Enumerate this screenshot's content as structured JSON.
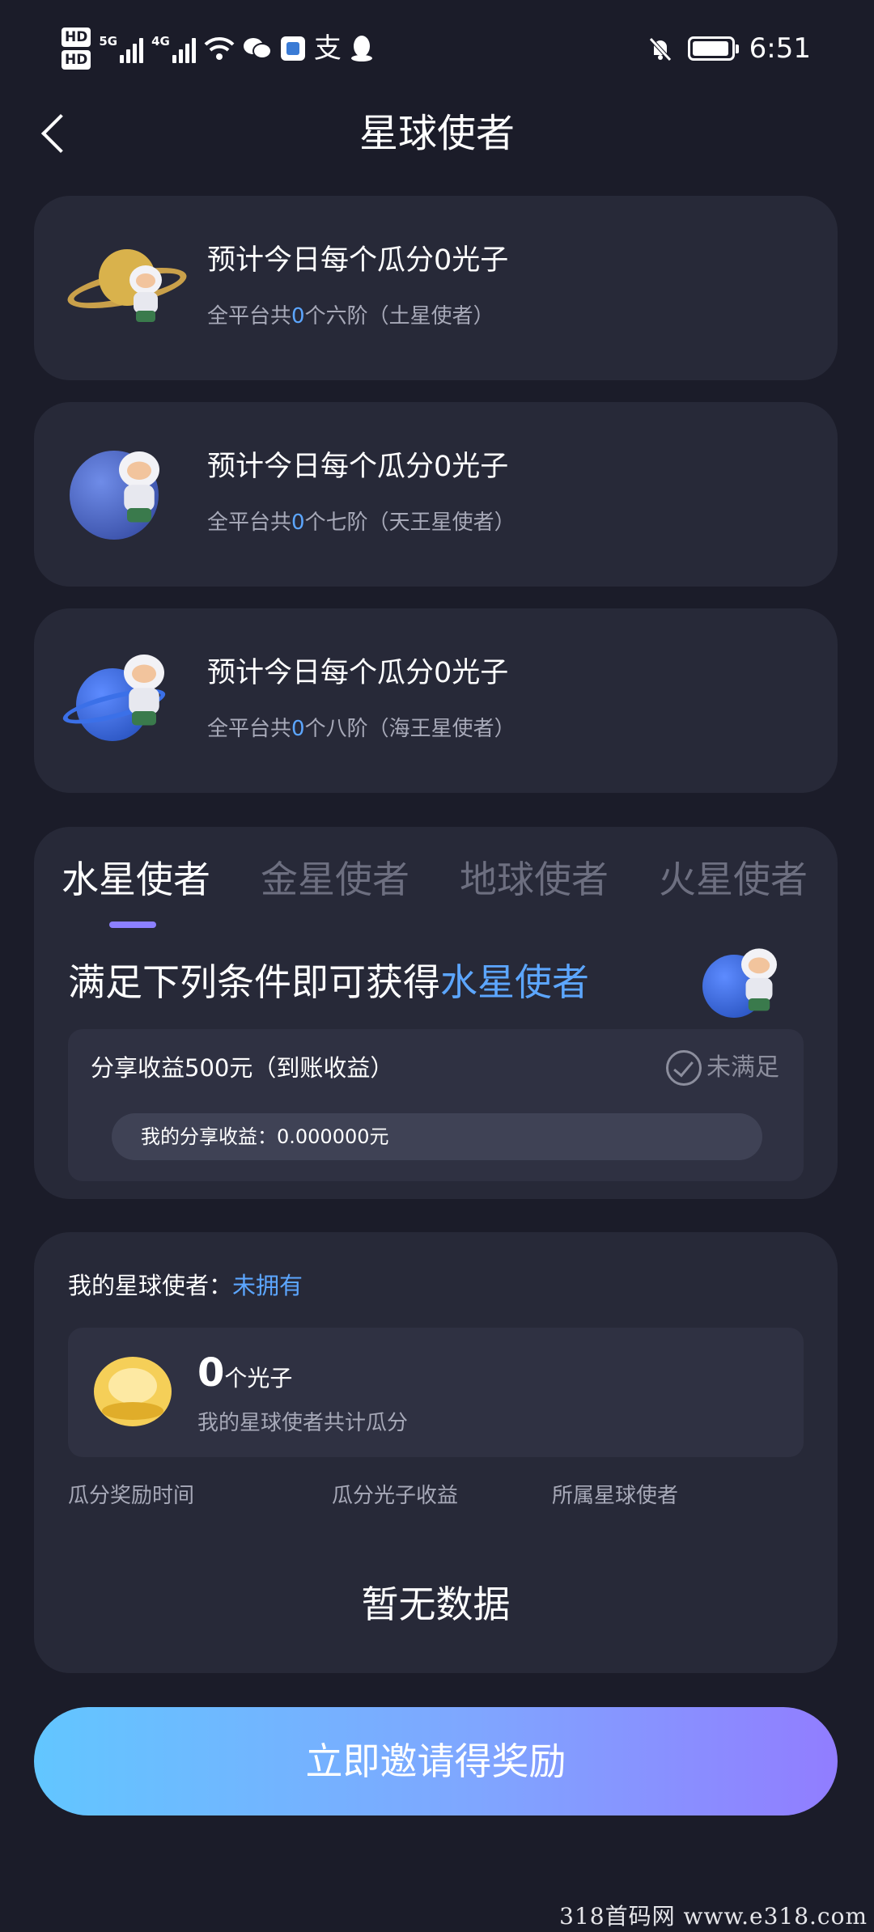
{
  "status_bar": {
    "hd1": "HD",
    "hd2": "HD",
    "net1": "5G",
    "net2": "4G",
    "time": "6:51"
  },
  "nav": {
    "title": "星球使者"
  },
  "planet_cards": [
    {
      "title": "预计今日每个瓜分0光子",
      "sub_prefix": "全平台共",
      "count": "0",
      "sub_suffix": "个六阶（土星使者）",
      "planet_color": "#d9b24c"
    },
    {
      "title": "预计今日每个瓜分0光子",
      "sub_prefix": "全平台共",
      "count": "0",
      "sub_suffix": "个七阶（天王星使者）",
      "planet_color": "#3f62c2"
    },
    {
      "title": "预计今日每个瓜分0光子",
      "sub_prefix": "全平台共",
      "count": "0",
      "sub_suffix": "个八阶（海王星使者）",
      "planet_color": "#2f64d8"
    }
  ],
  "tabs": {
    "items": [
      "水星使者",
      "金星使者",
      "地球使者",
      "火星使者"
    ],
    "active_index": 0
  },
  "condition": {
    "title_prefix": "满足下列条件即可获得",
    "title_highlight": "水星使者",
    "label": "分享收益500元（到账收益）",
    "status": "未满足",
    "progress_text": "我的分享收益：0.000000元",
    "progress_fraction": 0
  },
  "my_section": {
    "label": "我的星球使者：",
    "value": "未拥有",
    "photon_count": "0",
    "photon_unit": "个光子",
    "photon_desc": "我的星球使者共计瓜分",
    "columns": [
      "瓜分奖励时间",
      "瓜分光子收益",
      "所属星球使者"
    ],
    "empty_text": "暂无数据"
  },
  "invite_button": {
    "label": "立即邀请得奖励"
  },
  "watermark": "318首码网 www.e318.com",
  "colors": {
    "background": "#1b1c29",
    "card": "#272938",
    "accent_blue": "#5ca6ff",
    "tab_indicator": "#8c80ff"
  }
}
